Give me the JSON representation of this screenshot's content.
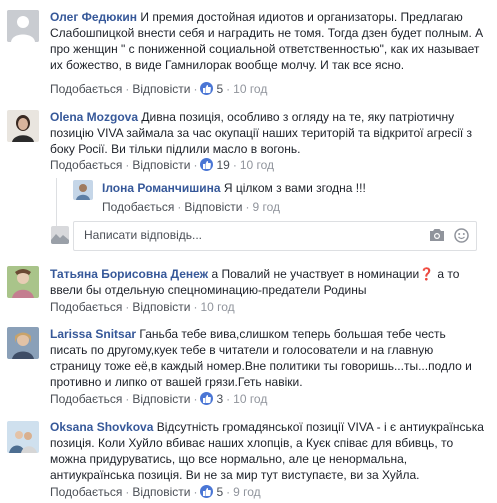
{
  "comments": [
    {
      "author": "Олег Федюкин",
      "text": "И премия достойная идиотов и организаторы. Предлагаю Слабошпицкой внести себя и наградить не томя. Тогда дзен будет полным. А про женщин \" с пониженной социальной ответственностью\", как их называет их божество, в виде Гамнилорак вообще молчу. И так все ясно.",
      "like_label": "Подобається",
      "reply_label": "Відповісти",
      "likes": "5",
      "time": "10 год"
    },
    {
      "author": "Olena Mozgova",
      "text": "Дивна позиція, особливо з огляду на те, яку патріотичну позицію VIVA займала за час окупації наших територій та відкритої агресії з боку Росії. Ви тільки підлили масло в вогонь.",
      "like_label": "Подобається",
      "reply_label": "Відповісти",
      "likes": "19",
      "time": "10 год"
    },
    {
      "author": "Ілона Романчишина",
      "text": "Я цілком з вами згодна !!!",
      "like_label": "Подобається",
      "reply_label": "Відповісти",
      "time": "9 год"
    },
    {
      "author": "Татьяна Борисовна Денеж",
      "text": "а Повалий не участвует в номинации❓ а то ввели бы отдельную спецноминацию-предатели Родины",
      "like_label": "Подобається",
      "reply_label": "Відповісти",
      "time": "10 год"
    },
    {
      "author": "Larissa Snitsar",
      "text": "Ганьба тебе вива,слишком теперь большая тебе честь писать по другому,куек тебе в читатели и голосователи и на главную страницу тоже её,в каждый номер.Вне политики ты говоришь...ты...подло и противно и липко от вашей грязи.Геть навіки.",
      "like_label": "Подобається",
      "reply_label": "Відповісти",
      "likes": "3",
      "time": "10 год"
    },
    {
      "author": "Oksana Shovkova",
      "text": "Відсутність громадянської позиції VIVA - і є антиукраїнська позиція. Коли Хуйло вбиває наших хлопців, а Куєк співає для вбивць, то можна придуруватись, що все нормально, але це ненормальна, антиукраїнська позиція. Ви не за мир тут виступаєте, ви за Хуйла.",
      "like_label": "Подобається",
      "reply_label": "Відповісти",
      "likes": "5",
      "time": "9 год"
    }
  ],
  "reply_input": {
    "placeholder": "Написати відповідь..."
  },
  "colors": {
    "author": "#365899",
    "like_badge": "#4a76d5",
    "meta": "#90949c"
  }
}
